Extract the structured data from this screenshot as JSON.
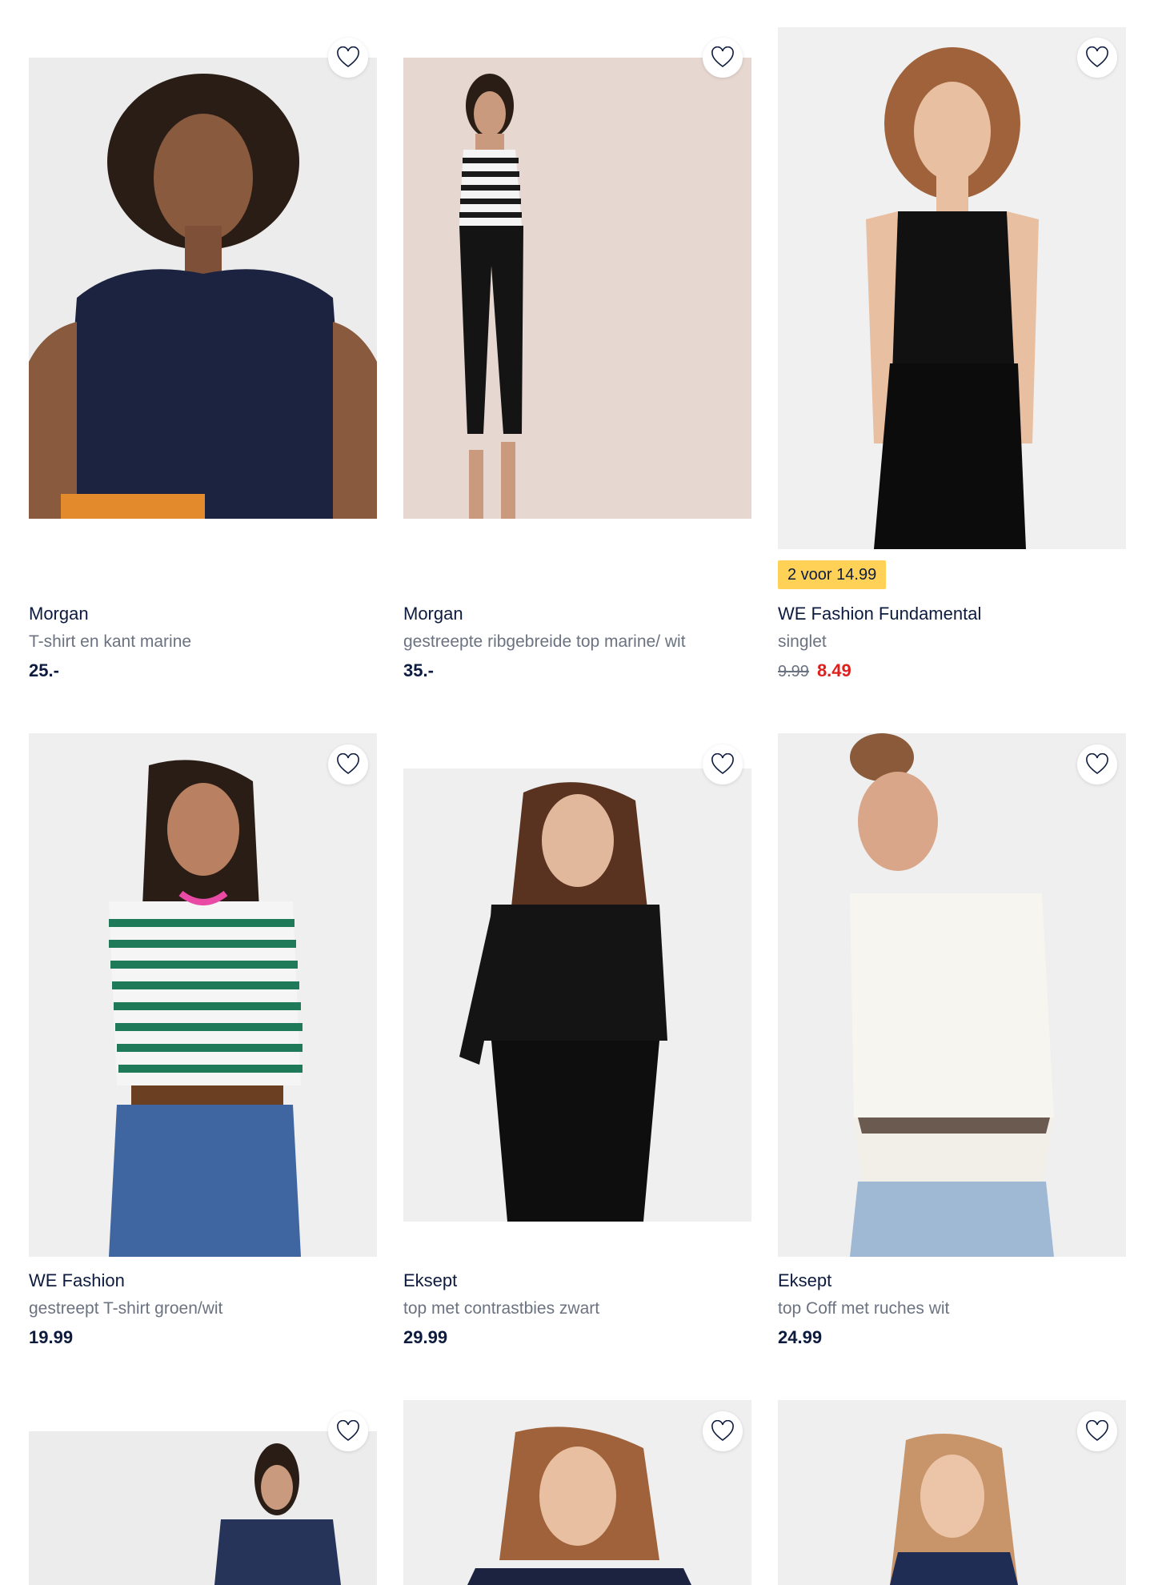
{
  "products": [
    {
      "brand": "Morgan",
      "description": "T-shirt en kant marine",
      "price": "25.-"
    },
    {
      "brand": "Morgan",
      "description": "gestreepte ribgebreide top marine/ wit",
      "price": "35.-"
    },
    {
      "brand": "WE Fashion Fundamental",
      "description": "singlet",
      "badge": "2 voor 14.99",
      "price_old": "9.99",
      "price_new": "8.49"
    },
    {
      "brand": "WE Fashion",
      "description": "gestreept T-shirt groen/wit",
      "price": "19.99"
    },
    {
      "brand": "Eksept",
      "description": "top met contrastbies zwart",
      "price": "29.99"
    },
    {
      "brand": "Eksept",
      "description": "top Coff met ruches wit",
      "price": "24.99"
    }
  ],
  "icons": {
    "favorite": "heart-outline-icon"
  },
  "colors": {
    "badge": "#ffd257",
    "sale_price": "#e0201d",
    "text": "#0d1b3e",
    "muted": "#6b7280"
  }
}
